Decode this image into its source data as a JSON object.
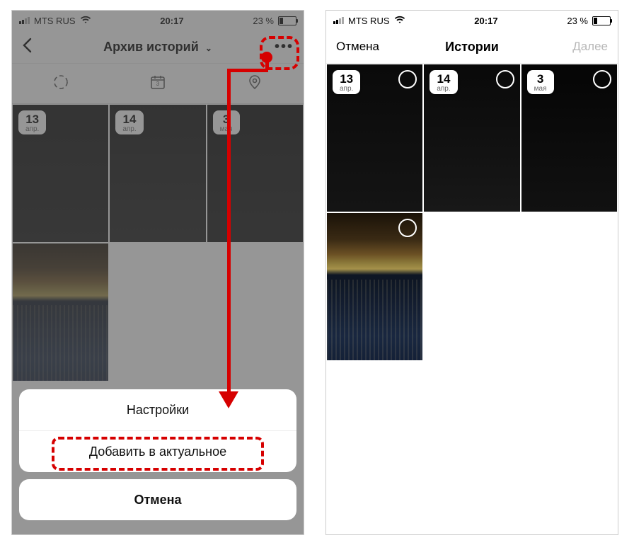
{
  "status": {
    "carrier": "MTS RUS",
    "time": "20:17",
    "battery_text": "23 %"
  },
  "left": {
    "nav_title": "Архив историй",
    "tiles": [
      {
        "day": "13",
        "month": "апр."
      },
      {
        "day": "14",
        "month": "апр."
      },
      {
        "day": "3",
        "month": "мая"
      }
    ],
    "sheet": {
      "settings": "Настройки",
      "add_highlight": "Добавить в актуальное",
      "cancel": "Отмена"
    }
  },
  "right": {
    "nav_cancel": "Отмена",
    "nav_title": "Истории",
    "nav_next": "Далее",
    "tiles": [
      {
        "day": "13",
        "month": "апр."
      },
      {
        "day": "14",
        "month": "апр."
      },
      {
        "day": "3",
        "month": "мая"
      }
    ]
  },
  "colors": {
    "annotation_red": "#d60000"
  }
}
